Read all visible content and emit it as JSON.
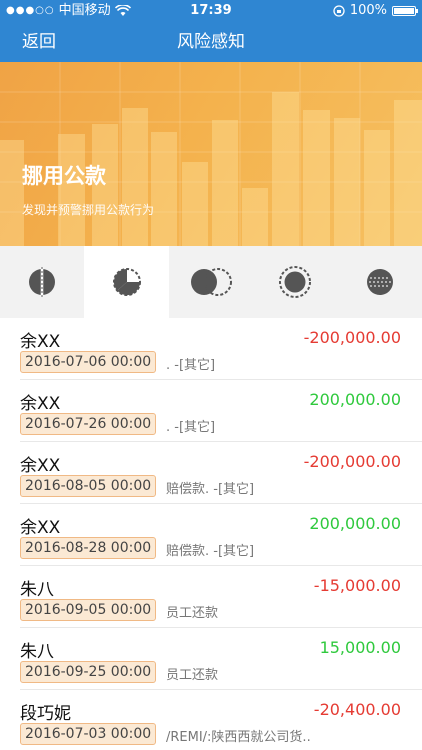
{
  "status_bar": {
    "carrier": "中国移动",
    "time": "17:39",
    "battery": "100%"
  },
  "nav": {
    "back_label": "返回",
    "title": "风险感知"
  },
  "banner": {
    "headline": "挪用公款",
    "subtitle": "发现并预警挪用公款行为"
  },
  "tabs": [
    {
      "icon": "split-circle-icon",
      "active": false
    },
    {
      "icon": "pie-chart-icon",
      "active": true
    },
    {
      "icon": "overlap-circles-icon",
      "active": false
    },
    {
      "icon": "ring-circle-icon",
      "active": false
    },
    {
      "icon": "grid-circle-icon",
      "active": false
    }
  ],
  "records": [
    {
      "name": "余XX",
      "amount": "-200,000.00",
      "sign": "neg",
      "date": "2016-07-06 00:00",
      "desc": ". -[其它]"
    },
    {
      "name": "余XX",
      "amount": "200,000.00",
      "sign": "pos",
      "date": "2016-07-26 00:00",
      "desc": ". -[其它]"
    },
    {
      "name": "余XX",
      "amount": "-200,000.00",
      "sign": "neg",
      "date": "2016-08-05 00:00",
      "desc": "赔偿款. -[其它]"
    },
    {
      "name": "余XX",
      "amount": "200,000.00",
      "sign": "pos",
      "date": "2016-08-28 00:00",
      "desc": "赔偿款. -[其它]"
    },
    {
      "name": "朱八",
      "amount": "-15,000.00",
      "sign": "neg",
      "date": "2016-09-05 00:00",
      "desc": "员工还款"
    },
    {
      "name": "朱八",
      "amount": "15,000.00",
      "sign": "pos",
      "date": "2016-09-25 00:00",
      "desc": "员工还款"
    },
    {
      "name": "段巧妮",
      "amount": "-20,400.00",
      "sign": "neg",
      "date": "2016-07-03 00:00",
      "desc": "/REMI/:陕西西就公司货.."
    }
  ],
  "colors": {
    "nav_blue": "#2f86d2",
    "banner_orange": "#f4b24d",
    "positive": "#2fc93d",
    "negative": "#e53b33"
  }
}
